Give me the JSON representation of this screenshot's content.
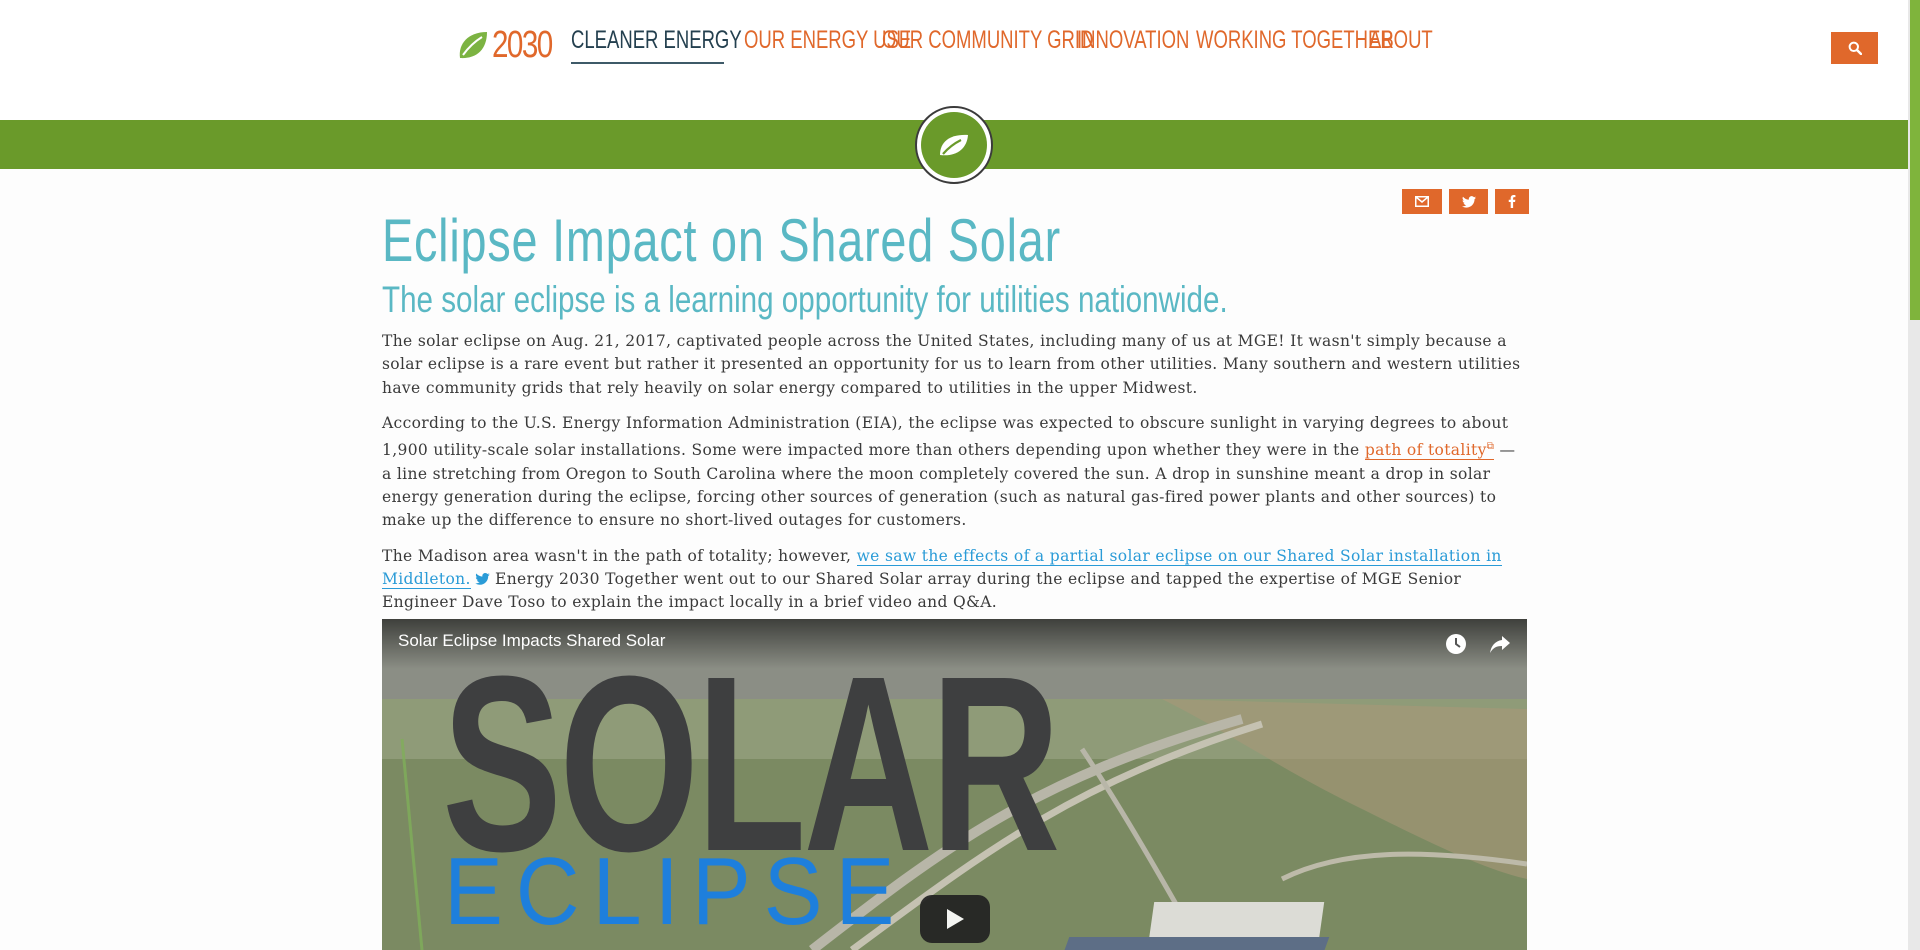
{
  "logo": {
    "text": "2030"
  },
  "nav": [
    {
      "label": "Cleaner Energy",
      "active": true
    },
    {
      "label": "Our Energy Use",
      "active": false
    },
    {
      "label": "Our Community Grid",
      "active": false
    },
    {
      "label": "Innovation",
      "active": false
    },
    {
      "label": "Working Together",
      "active": false
    },
    {
      "label": "About",
      "active": false
    }
  ],
  "colors": {
    "accent_orange": "#e0682b",
    "green": "#6a9a2a",
    "teal_heading": "#5ab8c4",
    "link_blue": "#2a9bd7"
  },
  "article": {
    "title": "Eclipse Impact on Shared Solar",
    "subtitle": "The solar eclipse is a learning opportunity for utilities nationwide.",
    "p1": "The solar eclipse on Aug. 21, 2017, captivated people across the United States, including many of us at MGE! It wasn't simply because a solar eclipse is a rare event but rather it presented an opportunity for us to learn from other utilities. Many southern and western utilities have community grids that rely heavily on solar energy compared to utilities in the upper Midwest.",
    "p2_before": "According to the U.S. Energy Information Administration (EIA), the eclipse was expected to obscure sunlight in varying degrees to about 1,900 utility-scale solar installations. Some were impacted more than others depending upon whether they were in the ",
    "p2_link": "path of totality",
    "p2_after": " — a line stretching from Oregon to South Carolina where the moon completely covered the sun. A drop in sunshine meant a drop in solar energy generation during the eclipse, forcing other sources of generation (such as natural gas-fired power plants and other sources) to make up the difference to ensure no short-lived outages for customers.",
    "p3_before": "The Madison area wasn't in the path of totality; however, ",
    "p3_link": "we saw the effects of a partial solar eclipse on our Shared Solar installation in Middleton.",
    "p3_after": " Energy 2030 Together went out to our Shared Solar array during the eclipse and tapped the expertise of MGE Senior Engineer Dave Toso to explain the impact locally in a brief video and Q&A."
  },
  "video": {
    "title": "Solar Eclipse Impacts Shared Solar",
    "thumb_word_1": "SOLAR",
    "thumb_word_2": "ECLIPSE"
  },
  "icons": {
    "search": "search-icon",
    "leaf": "leaf-icon",
    "email": "envelope-icon",
    "twitter": "twitter-icon",
    "facebook": "facebook-icon",
    "external": "external-link-icon",
    "watch_later": "clock-icon",
    "share": "share-icon",
    "play": "play-icon"
  }
}
